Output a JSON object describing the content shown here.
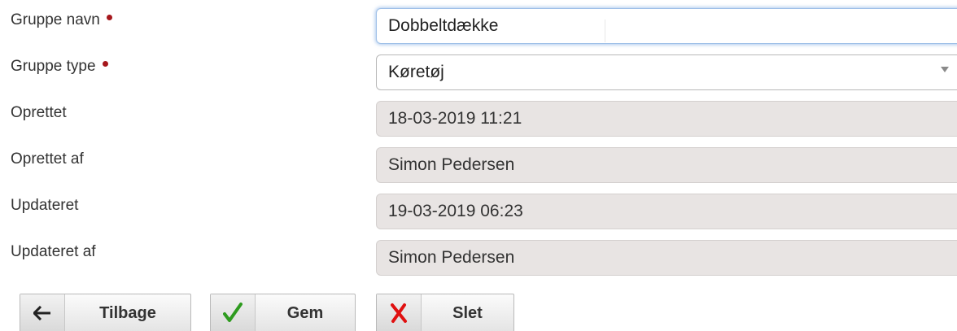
{
  "fields": [
    {
      "label": "Gruppe navn",
      "required": true,
      "value": "Dobbeltdække"
    },
    {
      "label": "Gruppe type",
      "required": true,
      "value": "Køretøj"
    },
    {
      "label": "Oprettet",
      "required": false,
      "value": "18-03-2019 11:21"
    },
    {
      "label": "Oprettet af",
      "required": false,
      "value": "Simon Pedersen"
    },
    {
      "label": "Updateret",
      "required": false,
      "value": "19-03-2019 06:23"
    },
    {
      "label": "Updateret af",
      "required": false,
      "value": "Simon Pedersen"
    }
  ],
  "buttons": {
    "back": {
      "label": "Tilbage",
      "icon": "arrow-left-icon"
    },
    "save": {
      "label": "Gem",
      "icon": "checkmark-icon"
    },
    "delete": {
      "label": "Slet",
      "icon": "x-icon"
    }
  },
  "colors": {
    "required_marker": "#a6171c",
    "readonly_background": "#e8e4e3",
    "focus_border": "#9fc0e8",
    "check_green": "#2e9b1f",
    "delete_red": "#e01010"
  }
}
